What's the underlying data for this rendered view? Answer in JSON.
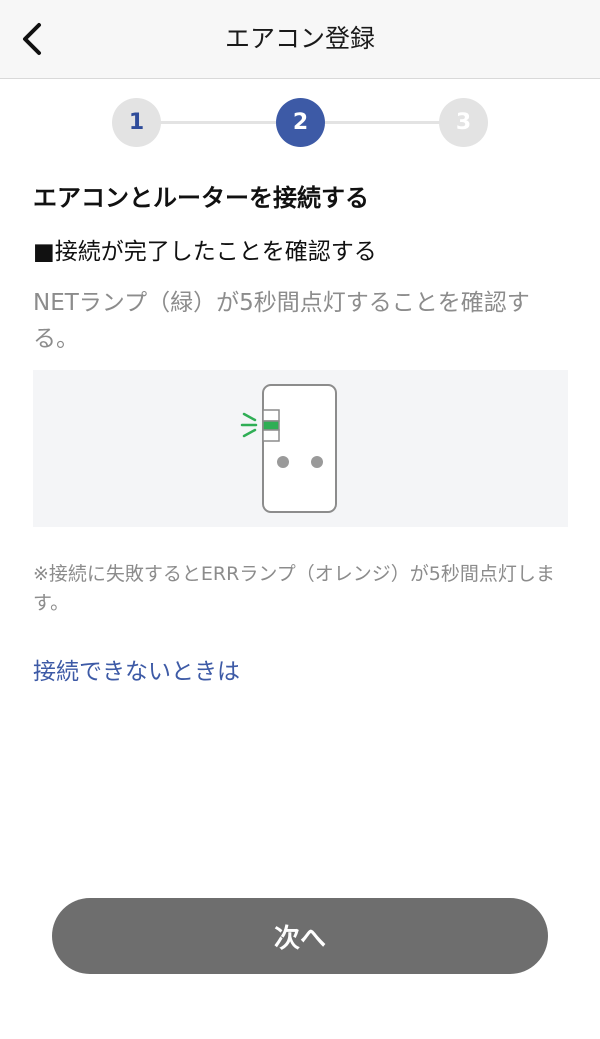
{
  "header": {
    "back_icon": "chevron-left-icon",
    "title": "エアコン登録"
  },
  "stepper": {
    "steps": [
      {
        "label": "1",
        "state": "completed"
      },
      {
        "label": "2",
        "state": "current"
      },
      {
        "label": "3",
        "state": "upcoming"
      }
    ],
    "active_color": "#3d5aa6",
    "inactive_color": "#e3e3e3"
  },
  "main": {
    "section_title": "エアコンとルーターを接続する",
    "subtitle": "■接続が完了したことを確認する",
    "description": "NETランプ（緑）が5秒間点灯することを確認する。",
    "illustration_icon": "device-net-lamp-icon",
    "lamp_color": "#2fae55",
    "note": "※接続に失敗するとERRランプ（オレンジ）が5秒間点灯します。",
    "help_link": "接続できないときは"
  },
  "footer": {
    "next_label": "次へ",
    "button_color": "#6e6e6e"
  }
}
